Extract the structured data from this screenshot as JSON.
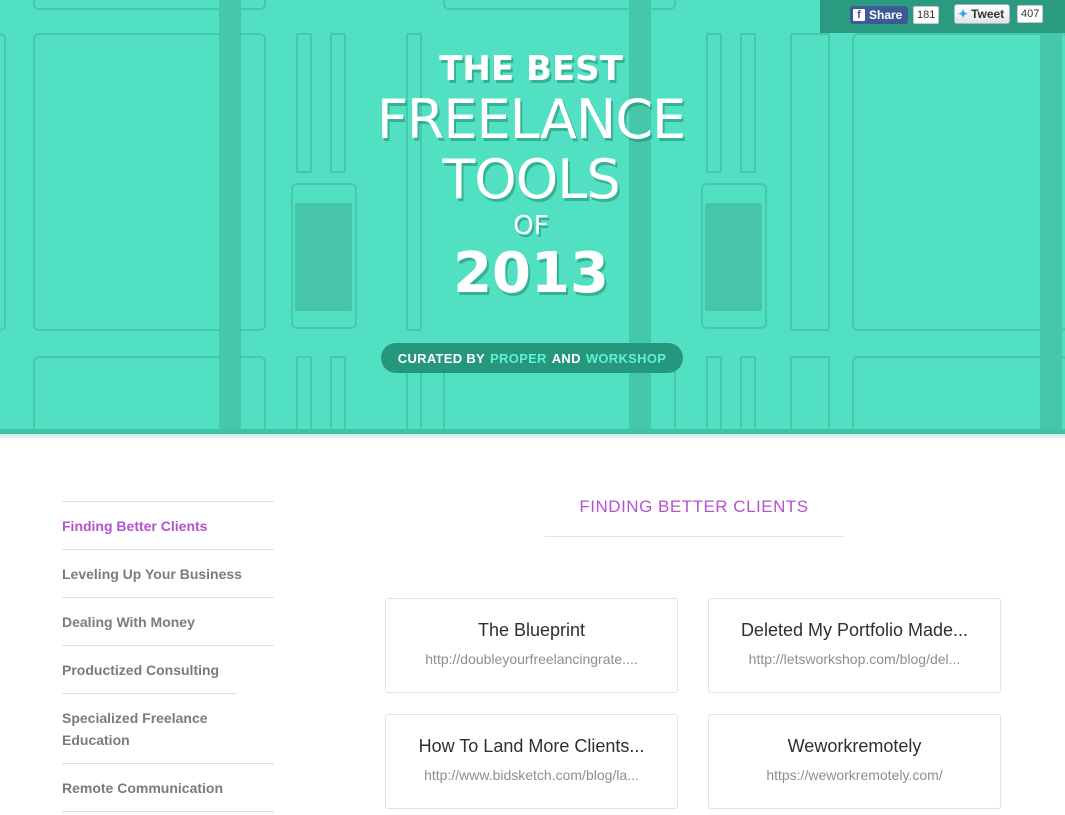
{
  "hero": {
    "title_line1": "THE BEST",
    "title_line2": "FREELANCE",
    "title_line3": "TOOLS",
    "title_line4": "OF",
    "title_line5": "2013",
    "curated_prefix": "CURATED BY",
    "curated_brand1": "PROPER",
    "curated_and": "AND",
    "curated_brand2": "WORKSHOP",
    "colors": {
      "background": "#52e0c2",
      "accent": "#63f0d0",
      "pill": "#24977d"
    }
  },
  "social": {
    "facebook_label": "Share",
    "facebook_icon": "facebook-icon",
    "facebook_count": "181",
    "twitter_label": "Tweet",
    "twitter_icon": "twitter-bird-icon",
    "twitter_count": "407"
  },
  "sidebar": {
    "items": [
      {
        "label": "Finding Better Clients",
        "active": true
      },
      {
        "label": "Leveling Up Your Business",
        "active": false
      },
      {
        "label": "Dealing With Money",
        "active": false
      },
      {
        "label": "Productized Consulting",
        "active": false
      },
      {
        "label": "Specialized Freelance Education",
        "active": false
      },
      {
        "label": "Remote Communication",
        "active": false
      }
    ],
    "active_color": "#b253cf"
  },
  "main": {
    "section_title": "FINDING BETTER CLIENTS",
    "cards": [
      {
        "title": "The Blueprint",
        "url": "http://doubleyourfreelancingrate...."
      },
      {
        "title": "Deleted My Portfolio Made...",
        "url": "http://letsworkshop.com/blog/del..."
      },
      {
        "title": "How To Land More Clients...",
        "url": "http://www.bidsketch.com/blog/la..."
      },
      {
        "title": "Weworkremotely",
        "url": "https://weworkremotely.com/"
      }
    ]
  }
}
